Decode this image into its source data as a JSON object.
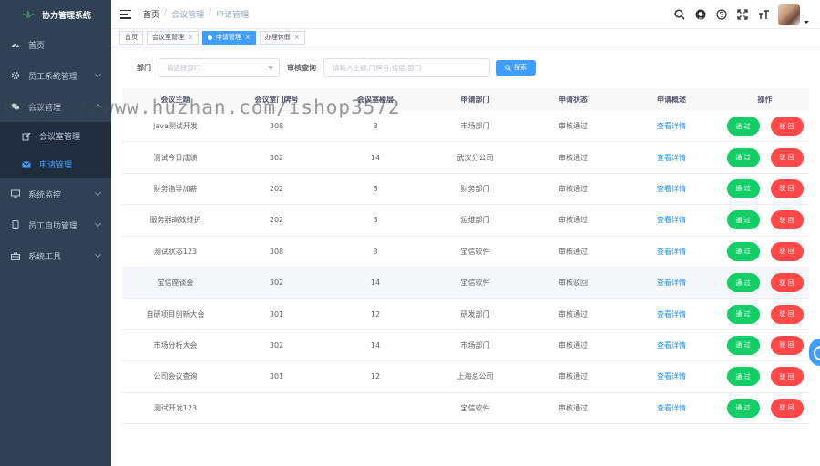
{
  "brand": {
    "title": "协力管理系统"
  },
  "sidebar": {
    "items": [
      {
        "label": "首页",
        "icon": "dashboard-icon"
      },
      {
        "label": "员工系统管理",
        "icon": "gear-icon"
      },
      {
        "label": "会议管理",
        "icon": "wechat-icon"
      },
      {
        "label": "系统监控",
        "icon": "monitor-icon"
      },
      {
        "label": "员工自助管理",
        "icon": "phone-icon"
      },
      {
        "label": "系统工具",
        "icon": "toolbox-icon"
      }
    ],
    "sub_items": [
      {
        "label": "会议室管理",
        "icon": "edit-icon"
      },
      {
        "label": "申请管理",
        "icon": "message-icon"
      }
    ]
  },
  "header": {
    "breadcrumb": [
      "首页",
      "会议管理",
      "申请管理"
    ],
    "separator": "/"
  },
  "tags": [
    {
      "label": "首页",
      "active": false
    },
    {
      "label": "会议室管理",
      "active": false
    },
    {
      "label": "申请管理",
      "active": true
    },
    {
      "label": "办理休假",
      "active": false
    }
  ],
  "search": {
    "dept_label": "部门",
    "dept_placeholder": "请选择部门",
    "query_label": "审核查询",
    "query_placeholder": "请输入主题,门牌号,楼层,部门",
    "button_label": "搜索"
  },
  "table": {
    "columns": [
      "会议主题",
      "会议室门牌号",
      "会议室楼层",
      "申请部门",
      "申请状态",
      "申请概述",
      "操作"
    ],
    "rows": [
      {
        "topic": "java测试开发",
        "room": "308",
        "floor": "3",
        "dept": "市场部门",
        "status": "审核通过",
        "detail": "查看详情"
      },
      {
        "topic": "测试今日成绩",
        "room": "302",
        "floor": "14",
        "dept": "武汉分公司",
        "status": "审核通过",
        "detail": "查看详情"
      },
      {
        "topic": "财务指导加薪",
        "room": "202",
        "floor": "3",
        "dept": "财务部门",
        "status": "审核通过",
        "detail": "查看详情"
      },
      {
        "topic": "服务器高效维护",
        "room": "202",
        "floor": "3",
        "dept": "运维部门",
        "status": "审核通过",
        "detail": "查看详情"
      },
      {
        "topic": "测试状态123",
        "room": "308",
        "floor": "3",
        "dept": "宝信软件",
        "status": "审核通过",
        "detail": "查看详情"
      },
      {
        "topic": "宝信座谈会",
        "room": "302",
        "floor": "14",
        "dept": "宝信软件",
        "status": "审核驳回",
        "detail": "查看详情"
      },
      {
        "topic": "自研项目创新大会",
        "room": "301",
        "floor": "12",
        "dept": "研发部门",
        "status": "审核通过",
        "detail": "查看详情"
      },
      {
        "topic": "市场分析大会",
        "room": "302",
        "floor": "14",
        "dept": "市场部门",
        "status": "审核通过",
        "detail": "查看详情"
      },
      {
        "topic": "公司会议查询",
        "room": "301",
        "floor": "12",
        "dept": "上海总公司",
        "status": "审核通过",
        "detail": "查看详情"
      },
      {
        "topic": "测试开发123",
        "room": "",
        "floor": "",
        "dept": "宝信软件",
        "status": "审核通过",
        "detail": "查看详情"
      }
    ],
    "pass_label": "通 过",
    "reject_label": "驳 回"
  },
  "watermark": "https://www.huzhan.com/ishop3572",
  "colors": {
    "sidebar": "#304156",
    "primary": "#409eff",
    "success": "#13ce66",
    "danger": "#ff4949"
  }
}
